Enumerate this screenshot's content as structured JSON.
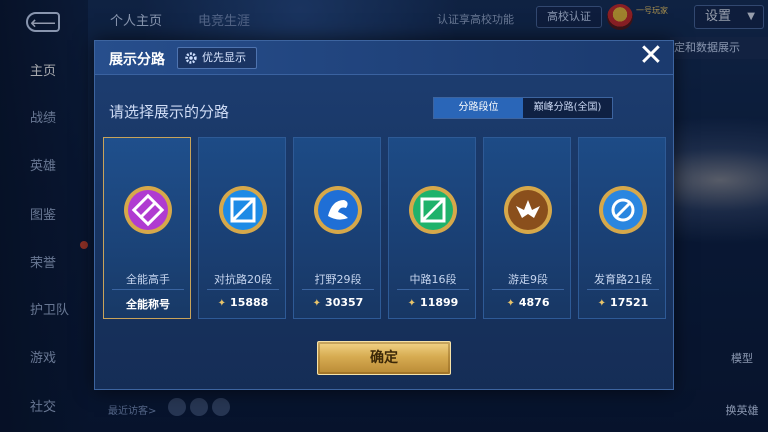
{
  "sidebar": {
    "back_icon": "back-arrow-icon",
    "items": [
      {
        "label": "主页",
        "active": true
      },
      {
        "label": "战绩",
        "active": false
      },
      {
        "label": "英雄",
        "active": false
      },
      {
        "label": "图鉴",
        "active": false
      },
      {
        "label": "荣誉",
        "active": false
      },
      {
        "label": "护卫队",
        "active": false
      },
      {
        "label": "游戏",
        "active": false
      },
      {
        "label": "社交",
        "active": false
      }
    ]
  },
  "topbar": {
    "tabs": [
      {
        "label": "个人主页",
        "active": true
      },
      {
        "label": "电竞生涯",
        "active": false
      }
    ],
    "promo_text": "认证享高校功能",
    "campus_badge": "高校认证",
    "user_tag": "一号玩家",
    "settings_label": "设置",
    "chip_label": "定和数据展示"
  },
  "background": {
    "right_labels": [
      "模型",
      "换英雄"
    ],
    "recent_visitors": "最近访客>"
  },
  "modal": {
    "title": "展示分路",
    "priority_label": "优先显示",
    "close_icon": "close-x-icon",
    "subtitle": "请选择展示的分路",
    "segment": {
      "left": "分路段位",
      "right": "巅峰分路(全国)",
      "selected": "left"
    },
    "cards": [
      {
        "name": "全能高手",
        "score": "全能称号",
        "icon": "all-round-emblem-icon",
        "color": "#b03bd1",
        "selected": true
      },
      {
        "name": "对抗路20段",
        "score": "15888",
        "icon": "clash-lane-emblem-icon",
        "color": "#1d8be6",
        "selected": false
      },
      {
        "name": "打野29段",
        "score": "30357",
        "icon": "jungle-emblem-icon",
        "color": "#1f6fd6",
        "selected": false
      },
      {
        "name": "中路16段",
        "score": "11899",
        "icon": "mid-lane-emblem-icon",
        "color": "#1fb26b",
        "selected": false
      },
      {
        "name": "游走9段",
        "score": "4876",
        "icon": "roam-emblem-icon",
        "color": "#b5762a",
        "selected": false
      },
      {
        "name": "发育路21段",
        "score": "17521",
        "icon": "farm-lane-emblem-icon",
        "color": "#2a86e0",
        "selected": false
      }
    ],
    "confirm_label": "确定"
  },
  "colors": {
    "accent_gold": "#d7ac52",
    "segment_active": "#2a66b8",
    "modal_bg": "#183461"
  }
}
